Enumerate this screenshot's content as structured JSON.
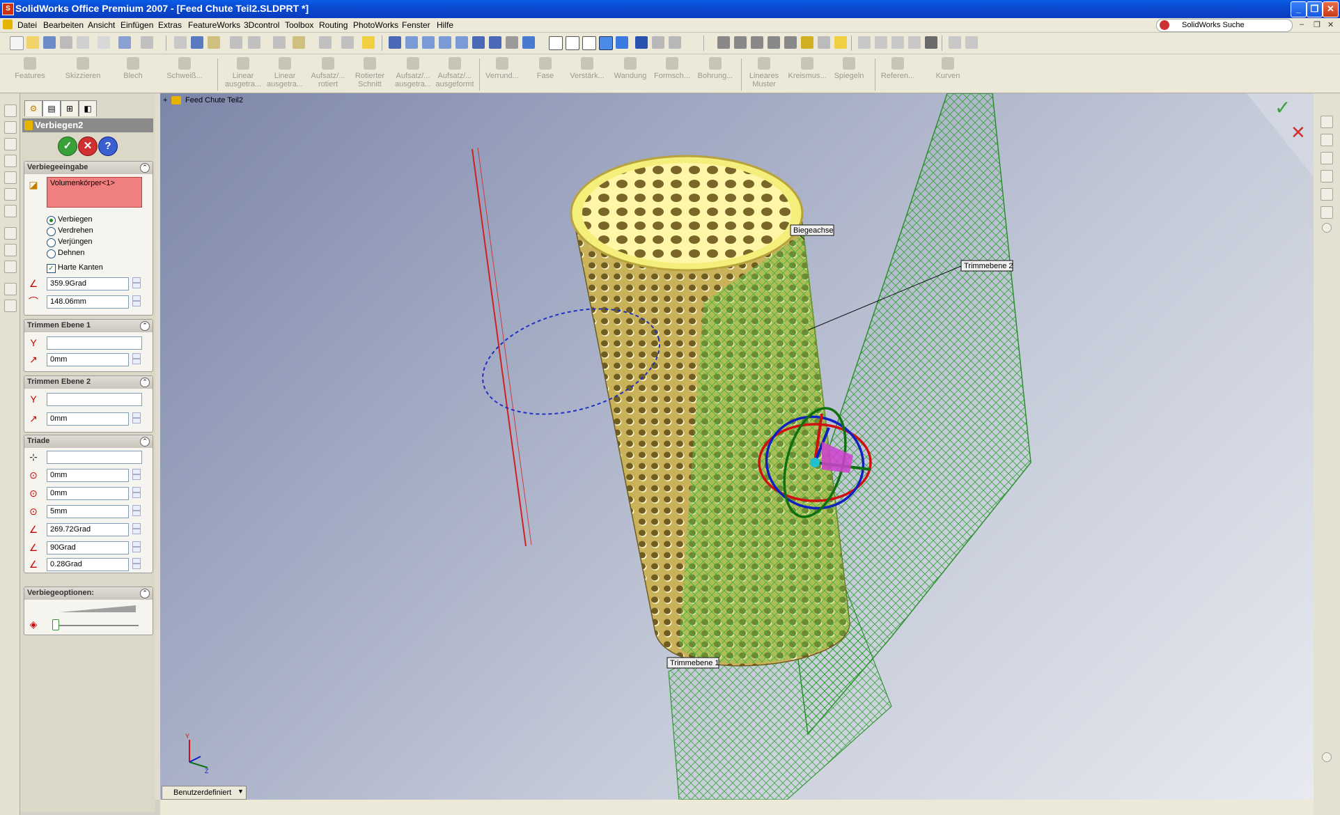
{
  "window": {
    "title": "SolidWorks Office Premium 2007 - [Feed Chute Teil2.SLDPRT *]"
  },
  "menu": [
    "Datei",
    "Bearbeiten",
    "Ansicht",
    "Einfügen",
    "Extras",
    "FeatureWorks",
    "3Dcontrol",
    "Toolbox",
    "Routing",
    "PhotoWorks",
    "Fenster",
    "Hilfe"
  ],
  "search": {
    "placeholder": "SolidWorks Suche"
  },
  "commands": [
    {
      "label": "Features"
    },
    {
      "label": "Skizzieren"
    },
    {
      "label": "Blech"
    },
    {
      "label": "Schweiß..."
    },
    {
      "label": "Linear ausgetra..."
    },
    {
      "label": "Linear ausgetra..."
    },
    {
      "label": "Aufsatz/... rotiert"
    },
    {
      "label": "Rotierter Schnitt"
    },
    {
      "label": "Aufsatz/... ausgetra..."
    },
    {
      "label": "Aufsatz/... ausgeformt"
    },
    {
      "label": "Verrund..."
    },
    {
      "label": "Fase"
    },
    {
      "label": "Verstärk..."
    },
    {
      "label": "Wandung"
    },
    {
      "label": "Formsch..."
    },
    {
      "label": "Bohrung..."
    },
    {
      "label": "Lineares Muster"
    },
    {
      "label": "Kreismus..."
    },
    {
      "label": "Spiegeln"
    },
    {
      "label": "Referen..."
    },
    {
      "label": "Kurven"
    }
  ],
  "property_manager": {
    "title": "Verbiegen2",
    "groups": {
      "bend_input": {
        "title": "Verbiegeeingabe",
        "body": "Volumenkörper<1>",
        "options": [
          "Verbiegen",
          "Verdrehen",
          "Verjüngen",
          "Dehnen"
        ],
        "selected": "Verbiegen",
        "hard_edges": "Harte Kanten",
        "angle": "359.9Grad",
        "radius": "148.06mm"
      },
      "trim1": {
        "title": "Trimmen Ebene 1",
        "value": "",
        "offset": "0mm"
      },
      "trim2": {
        "title": "Trimmen Ebene 2",
        "value": "",
        "offset": "0mm"
      },
      "triad": {
        "title": "Triade",
        "x": "0mm",
        "y": "0mm",
        "z": "5mm",
        "rx": "269.72Grad",
        "ry": "90Grad",
        "rz": "0.28Grad"
      },
      "bend_options": {
        "title": "Verbiegeoptionen:"
      }
    }
  },
  "viewport": {
    "tree_root": "Feed Chute Teil2",
    "callouts": {
      "bend_axis": "Biegeachse",
      "trim_plane_2": "Trimmebene 2",
      "trim_plane_1": "Trimmebene 1"
    },
    "view_selector": "Benutzerdefiniert"
  },
  "colors": {
    "part": "#e8d86a",
    "plane": "#2a9a2a",
    "accent": "#0a4ad0"
  }
}
